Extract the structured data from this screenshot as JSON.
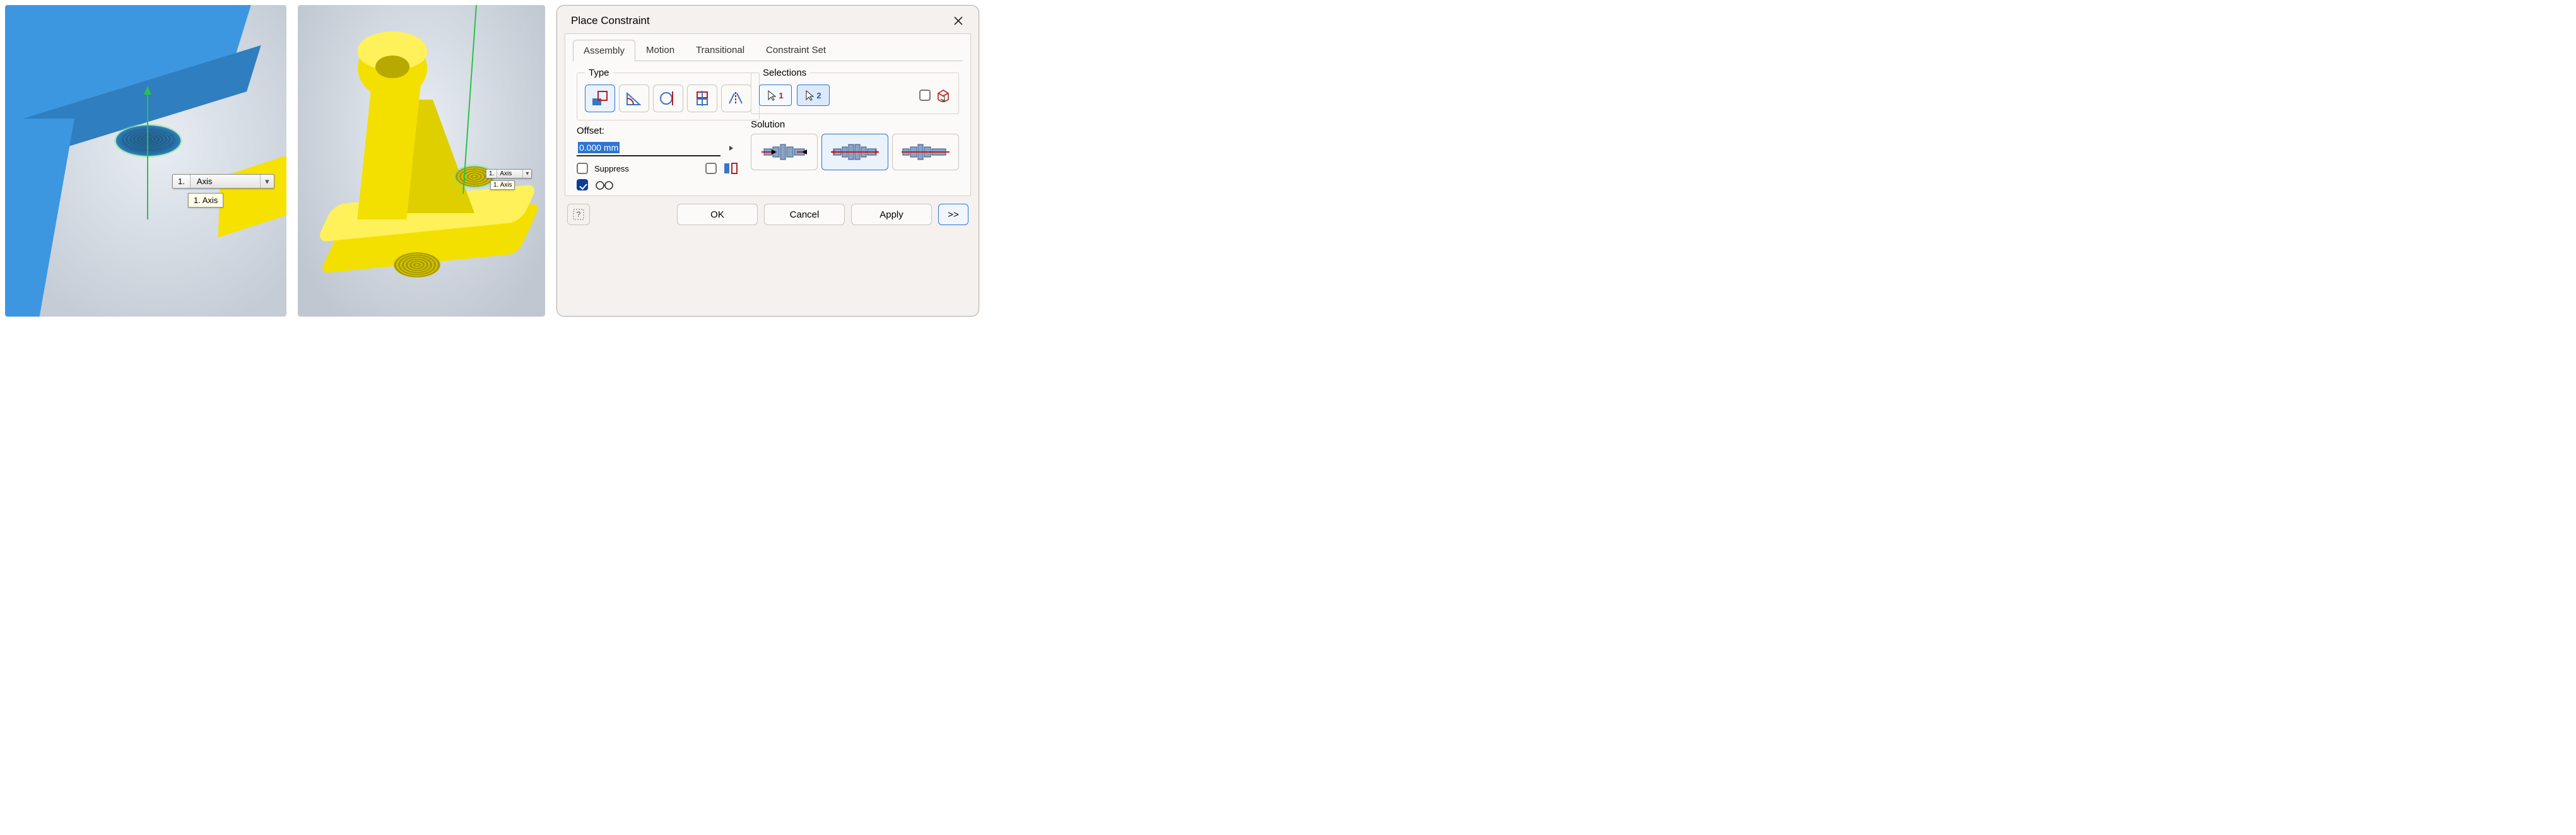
{
  "viewport1": {
    "selection_number": "1.",
    "selection_label": "Axis",
    "tooltip_number": "1.",
    "tooltip_label": "Axis"
  },
  "viewport2": {
    "selection_number": "1.",
    "selection_label": "Axis",
    "tooltip_number": "1.",
    "tooltip_label": "Axis"
  },
  "dialog": {
    "title": "Place Constraint",
    "tabs": {
      "assembly": "Assembly",
      "motion": "Motion",
      "transitional": "Transitional",
      "constraint_set": "Constraint Set"
    },
    "type_label": "Type",
    "selections_label": "Selections",
    "selection1_num": "1",
    "selection2_num": "2",
    "offset_label": "Offset:",
    "offset_value": "0.000 mm",
    "solution_label": "Solution",
    "suppress_label": "Suppress",
    "buttons": {
      "ok": "OK",
      "cancel": "Cancel",
      "apply": "Apply",
      "more": ">>"
    },
    "help_tooltip": "?"
  }
}
